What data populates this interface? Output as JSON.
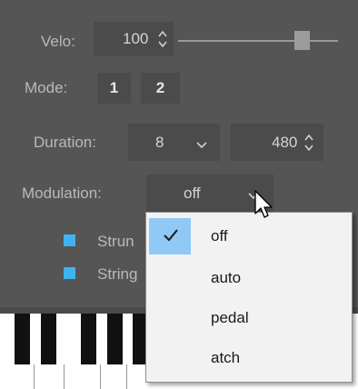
{
  "velo": {
    "label": "Velo:",
    "value": "100",
    "slider_fraction": 0.8
  },
  "mode": {
    "label": "Mode:",
    "buttons": [
      "1",
      "2"
    ]
  },
  "duration": {
    "label": "Duration:",
    "value": "8",
    "value2": "480"
  },
  "modulation": {
    "label": "Modulation:",
    "value": "off"
  },
  "checkboxes": [
    {
      "label": "Strun",
      "checked": true
    },
    {
      "label": "String",
      "checked": true
    }
  ],
  "dropdown": {
    "items": [
      "off",
      "auto",
      "pedal",
      "atch"
    ],
    "selected": "off"
  },
  "colors": {
    "panel": "#555555",
    "accent": "#3fb3f2",
    "highlight": "#90c8f6"
  },
  "icons": [
    "spin-up-down-icon",
    "chevron-down-icon",
    "checkmark-icon",
    "mouse-pointer-icon"
  ]
}
